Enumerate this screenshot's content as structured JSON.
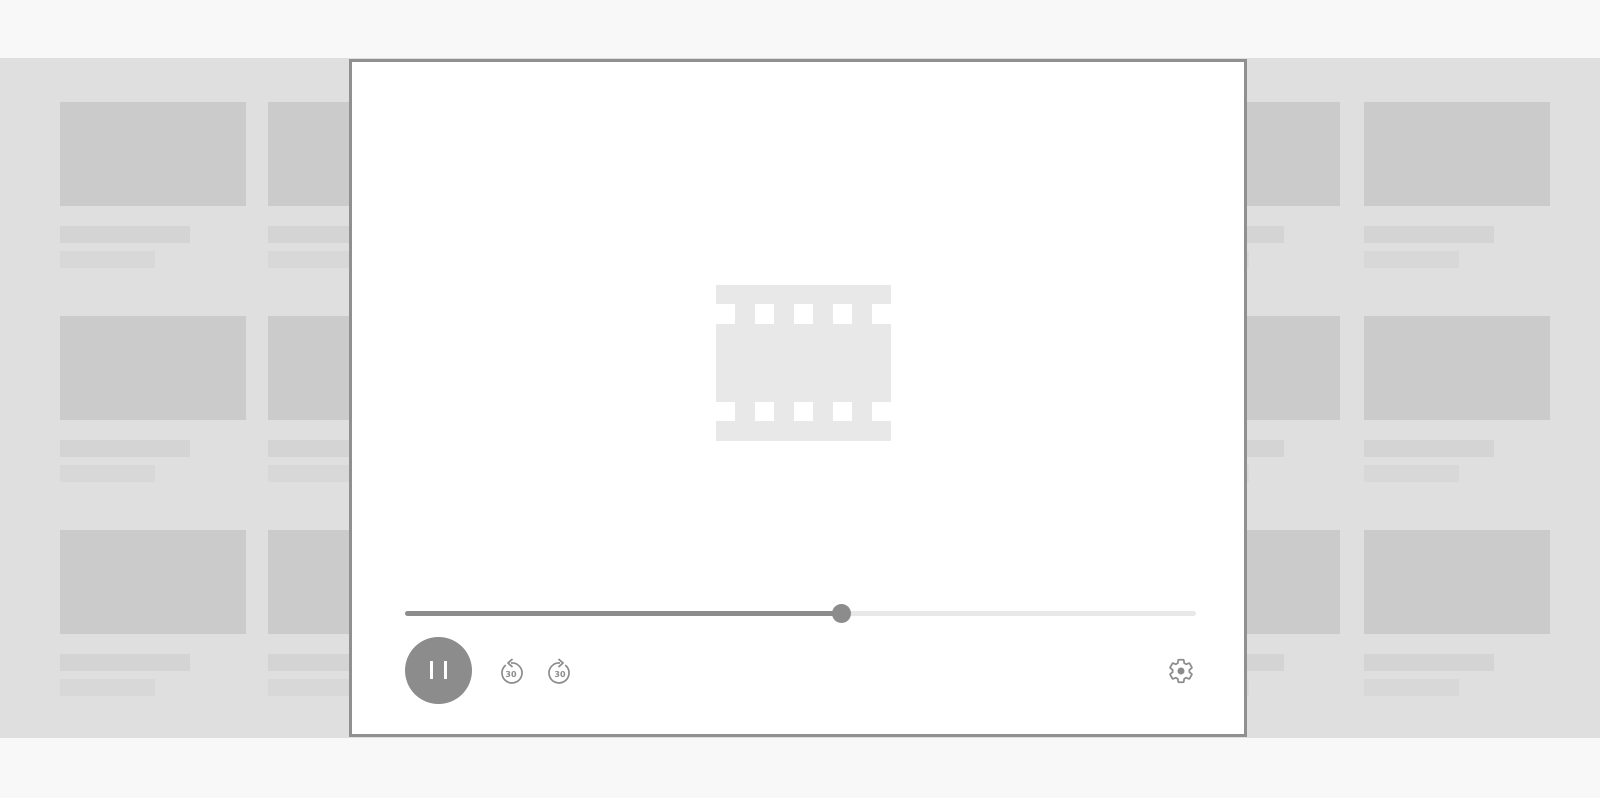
{
  "player": {
    "state": "playing",
    "progress_fraction": 0.551,
    "rewind_label": "30",
    "forward_label": "30",
    "icons": {
      "placeholder": "film-icon",
      "play_toggle": "pause-icon",
      "rewind": "rewind-30-icon",
      "forward": "forward-30-icon",
      "settings": "gear-icon"
    }
  },
  "colors": {
    "accent": "#8c8c8c",
    "track": "#e8e8e8",
    "backdrop": "#dfdfdf",
    "placeholder_block": "#cbcbcb"
  },
  "background_grid": {
    "rows": 3,
    "columns": 7
  }
}
